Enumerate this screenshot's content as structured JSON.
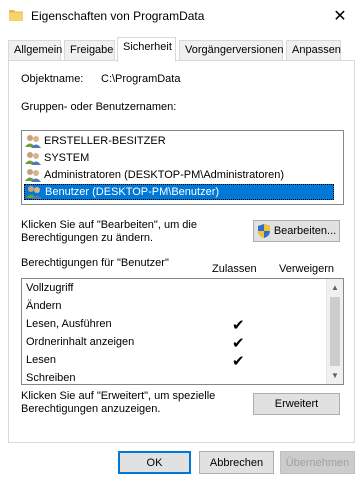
{
  "window": {
    "title": "Eigenschaften von ProgramData",
    "close_glyph": "✕"
  },
  "tabs": [
    {
      "label": "Allgemein"
    },
    {
      "label": "Freigabe"
    },
    {
      "label": "Sicherheit",
      "active": true
    },
    {
      "label": "Vorgängerversionen"
    },
    {
      "label": "Anpassen"
    }
  ],
  "object": {
    "label": "Objektname:",
    "value": "C:\\ProgramData"
  },
  "groups": {
    "label": "Gruppen- oder Benutzernamen:",
    "items": [
      {
        "name": "ERSTELLER-BESITZER"
      },
      {
        "name": "SYSTEM"
      },
      {
        "name": "Administratoren (DESKTOP-PM\\Administratoren)"
      },
      {
        "name": "Benutzer (DESKTOP-PM\\Benutzer)",
        "selected": true
      }
    ]
  },
  "edit": {
    "hint": "Klicken Sie auf \"Bearbeiten\", um die Berechtigungen zu ändern.",
    "button": "Bearbeiten..."
  },
  "permissions": {
    "label": "Berechtigungen für \"Benutzer\"",
    "allow_header": "Zulassen",
    "deny_header": "Verweigern",
    "rows": [
      {
        "name": "Vollzugriff",
        "allow": false
      },
      {
        "name": "Ändern",
        "allow": false
      },
      {
        "name": "Lesen, Ausführen",
        "allow": true
      },
      {
        "name": "Ordnerinhalt anzeigen",
        "allow": true
      },
      {
        "name": "Lesen",
        "allow": true
      },
      {
        "name": "Schreiben",
        "allow": false
      }
    ]
  },
  "advanced": {
    "hint": "Klicken Sie auf \"Erweitert\", um spezielle Berechtigungen anzuzeigen.",
    "button": "Erweitert"
  },
  "footer": {
    "ok": "OK",
    "cancel": "Abbrechen",
    "apply": "Übernehmen"
  },
  "colors": {
    "selection": "#0078d7",
    "folder": "#e8b84a"
  }
}
